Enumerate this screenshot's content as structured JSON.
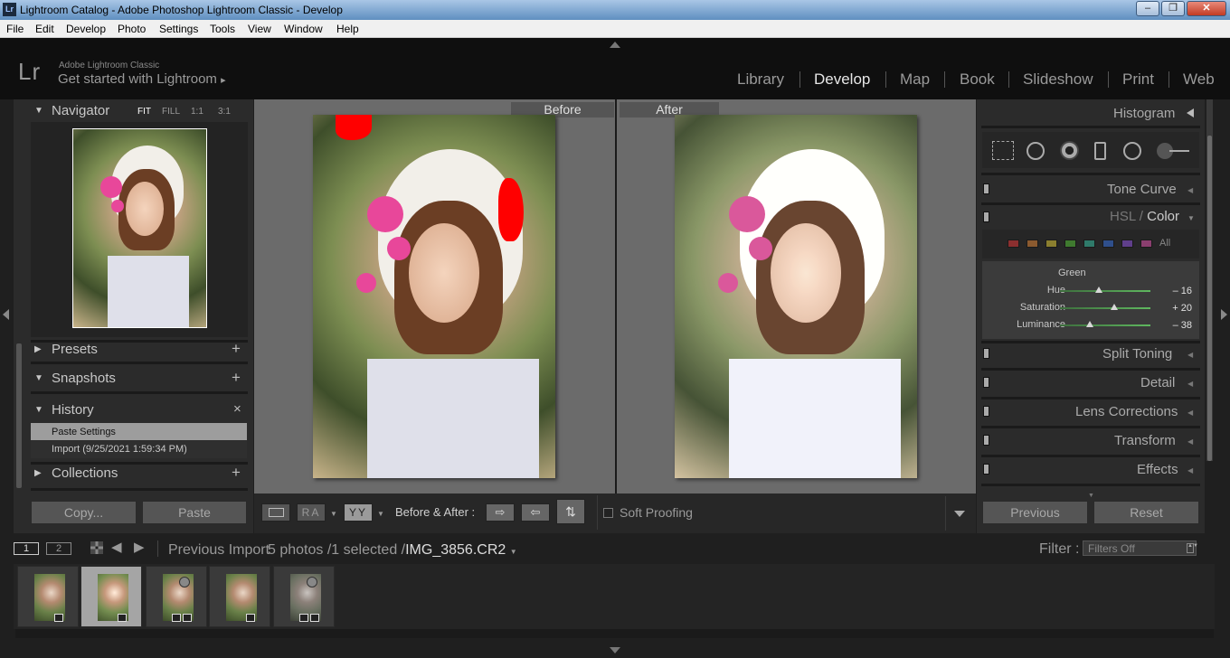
{
  "window": {
    "title": "Lightroom Catalog - Adobe Photoshop Lightroom Classic - Develop",
    "app_icon": "Lr"
  },
  "menu": [
    "File",
    "Edit",
    "Develop",
    "Photo",
    "Settings",
    "Tools",
    "View",
    "Window",
    "Help"
  ],
  "identity": {
    "logo": "Lr",
    "brand": "Adobe Lightroom Classic",
    "tagline": "Get started with Lightroom",
    "tagline_arrow": "▸"
  },
  "modules": [
    "Library",
    "Develop",
    "Map",
    "Book",
    "Slideshow",
    "Print",
    "Web"
  ],
  "active_module": "Develop",
  "left": {
    "navigator": {
      "title": "Navigator",
      "zoom": [
        "FIT",
        "FILL",
        "1:1",
        "3:1"
      ]
    },
    "presets": {
      "title": "Presets",
      "action": "+"
    },
    "snapshots": {
      "title": "Snapshots",
      "action": "+"
    },
    "history": {
      "title": "History",
      "action": "×",
      "items": [
        "Paste Settings",
        "Import (9/25/2021 1:59:34 PM)"
      ]
    },
    "collections": {
      "title": "Collections",
      "action": "+"
    },
    "copy_label": "Copy...",
    "paste_label": "Paste"
  },
  "center": {
    "before_label": "Before",
    "after_label": "After"
  },
  "toolbar": {
    "ra": "RA",
    "yy": "YY",
    "before_after_label": "Before & After :",
    "soft_proofing": "Soft Proofing"
  },
  "right": {
    "histogram": "Histogram",
    "tone_curve": "Tone Curve",
    "hsl": {
      "hsl": "HSL",
      "slash": " / ",
      "color": "Color",
      "all": "All",
      "group": "Green",
      "sliders": [
        {
          "label": "Hue",
          "value": "– 16",
          "position": 0.43
        },
        {
          "label": "Saturation",
          "value": "+ 20",
          "position": 0.6
        },
        {
          "label": "Luminance",
          "value": "– 38",
          "position": 0.33
        }
      ],
      "swatches": [
        "#8b2f2f",
        "#8b5a2f",
        "#8b7f2f",
        "#3f7a2f",
        "#2f7a6a",
        "#2f4f8b",
        "#5f3f8b",
        "#8b3f6f"
      ]
    },
    "split_toning": "Split Toning",
    "detail": "Detail",
    "lens_corrections": "Lens Corrections",
    "transform": "Transform",
    "effects": "Effects",
    "previous_label": "Previous",
    "reset_label": "Reset"
  },
  "filmbar": {
    "view1": "1",
    "view2": "2",
    "source": "Previous Import",
    "count": "5 photos /1 selected /",
    "filename": "IMG_3856.CR2",
    "filter_label": "Filter :",
    "filter_value": "Filters Off"
  },
  "filmstrip": {
    "thumbnails": 5,
    "selected_index": 1
  }
}
